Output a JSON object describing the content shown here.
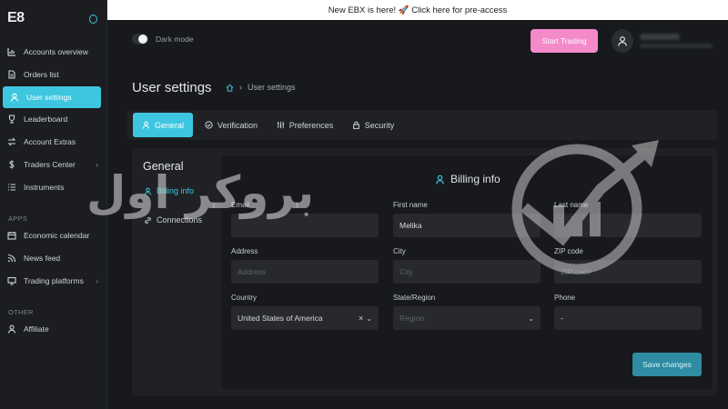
{
  "app": {
    "logo": "E8"
  },
  "banner": {
    "text": "New EBX is here! 🚀 Click here for pre-access"
  },
  "sidebar": {
    "items": [
      {
        "label": "Accounts overview",
        "icon": "chart-icon"
      },
      {
        "label": "Orders list",
        "icon": "document-icon"
      },
      {
        "label": "User settings",
        "icon": "user-icon",
        "active": true
      },
      {
        "label": "Leaderboard",
        "icon": "trophy-icon"
      },
      {
        "label": "Account Extras",
        "icon": "swap-icon"
      },
      {
        "label": "Traders Center",
        "icon": "dollar-icon",
        "chevron": "›"
      },
      {
        "label": "Instruments",
        "icon": "list-icon"
      }
    ],
    "apps_label": "APPS",
    "apps": [
      {
        "label": "Economic calendar",
        "icon": "calendar-icon"
      },
      {
        "label": "News feed",
        "icon": "rss-icon"
      },
      {
        "label": "Trading platforms",
        "icon": "monitor-icon",
        "chevron": "›"
      }
    ],
    "other_label": "OTHER",
    "other": [
      {
        "label": "Affiliate",
        "icon": "user-icon"
      }
    ]
  },
  "header": {
    "dark_mode_label": "Dark mode",
    "start_trading": "Start Trading"
  },
  "page": {
    "title": "User settings",
    "breadcrumb": "User settings"
  },
  "tabs": [
    {
      "label": "General",
      "active": true
    },
    {
      "label": "Verification"
    },
    {
      "label": "Preferences"
    },
    {
      "label": "Security"
    }
  ],
  "general": {
    "title": "General",
    "links": [
      "Billing info",
      "Connections"
    ]
  },
  "billing": {
    "title": "Billing info",
    "email_label": "Email",
    "first_name_label": "First name",
    "first_name_value": "Melika",
    "last_name_label": "Last name",
    "address_label": "Address",
    "address_placeholder": "Address",
    "city_label": "City",
    "city_placeholder": "City",
    "zip_label": "ZIP code",
    "zip_placeholder": "ZIP code",
    "country_label": "Country",
    "country_value": "United States of America",
    "state_label": "State/Region",
    "state_placeholder": "Region",
    "phone_label": "Phone",
    "phone_value": "-",
    "clear_glyph": "×",
    "caret_glyph": "⌄",
    "save_label": "Save changes"
  },
  "watermark": {
    "text": "بروکر اول"
  },
  "colors": {
    "accent": "#3ec6e0",
    "cta": "#f58acb",
    "save": "#2e8ca3",
    "bg": "#17191c"
  }
}
